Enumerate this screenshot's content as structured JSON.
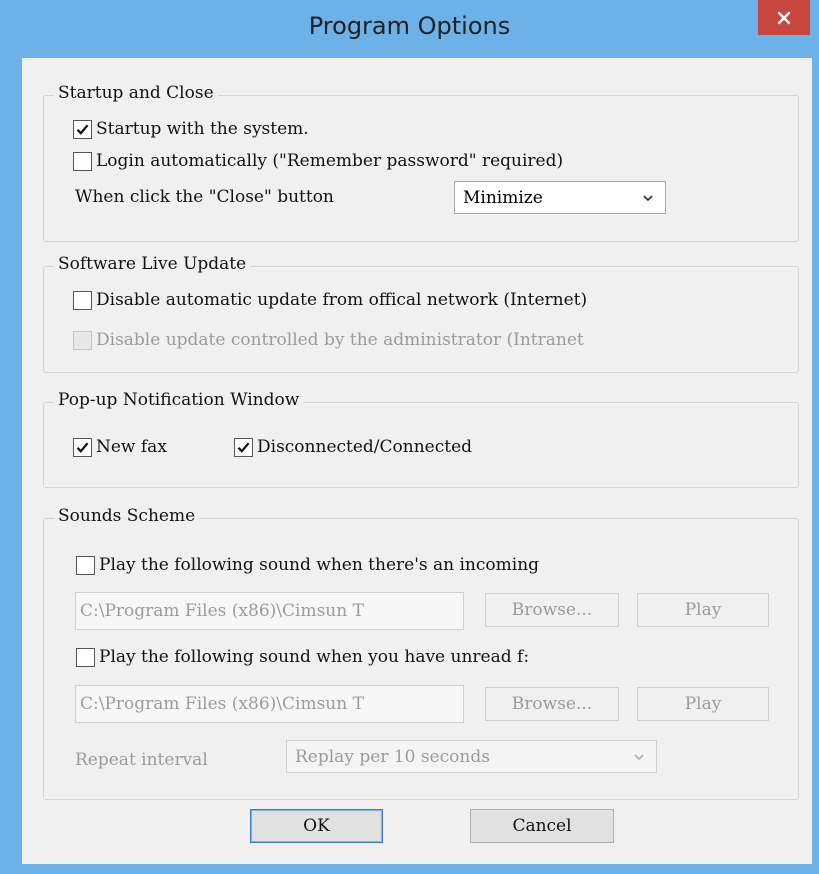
{
  "window": {
    "title": "Program Options",
    "accent": "#6cb2e8",
    "close_color": "#c7473f"
  },
  "startup": {
    "legend": "Startup and Close",
    "startup_with_system": {
      "label": "Startup with the system.",
      "checked": true
    },
    "login_auto": {
      "label": "Login automatically (\"Remember password\" required)",
      "checked": false
    },
    "close_action_label": "When click the \"Close\" button",
    "close_action_value": "Minimize"
  },
  "update": {
    "legend": "Software Live Update",
    "disable_internet": {
      "label": "Disable automatic update from offical network (Internet)",
      "checked": false
    },
    "disable_intranet": {
      "label": "Disable update controlled by the administrator (Intranet",
      "checked": false,
      "enabled": false
    }
  },
  "popup": {
    "legend": "Pop-up Notification Window",
    "new_fax": {
      "label": "New fax",
      "checked": true
    },
    "disconnected": {
      "label": "Disconnected/Connected",
      "checked": true
    }
  },
  "sounds": {
    "legend": "Sounds Scheme",
    "incoming": {
      "label": "Play the following sound when there's an incoming",
      "checked": false,
      "path": "C:\\Program Files (x86)\\Cimsun T",
      "browse": "Browse...",
      "play": "Play"
    },
    "unread": {
      "label": "Play the following sound when you have unread f:",
      "checked": false,
      "path": "C:\\Program Files (x86)\\Cimsun T",
      "browse": "Browse...",
      "play": "Play"
    },
    "repeat_label": "Repeat interval",
    "repeat_value": "Replay per 10 seconds"
  },
  "footer": {
    "ok": "OK",
    "cancel": "Cancel"
  }
}
